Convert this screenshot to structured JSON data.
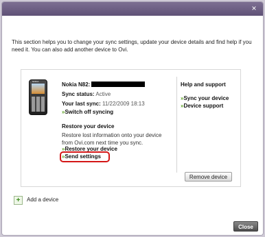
{
  "intro": {
    "text": "This section helps you to change your sync settings, update your device details and find help if you need it. You can also add another device to Ovi."
  },
  "device": {
    "name_label": "Nokia N82:",
    "sync_status_label": "Sync status:",
    "sync_status_value": "Active",
    "last_sync_label": "Your last sync:",
    "last_sync_value": "11/22/2009 18:13",
    "switch_off_link": "Switch off syncing",
    "phone_brand": "NOKIA"
  },
  "restore": {
    "title": "Restore your device",
    "description": "Restore lost information onto your device from Ovi.com next time you sync.",
    "restore_link": "Restore your device",
    "send_settings_link": "Send settings"
  },
  "help": {
    "title": "Help and support",
    "links": [
      "Sync your device",
      "Device support"
    ]
  },
  "buttons": {
    "remove_device": "Remove device",
    "close": "Close",
    "add_device": "Add a device"
  },
  "icons": {
    "link_arrow": "»",
    "plus": "+",
    "dialog_close": "×"
  },
  "colors": {
    "highlight": "#d41616",
    "link_arrow": "#5aa020"
  }
}
